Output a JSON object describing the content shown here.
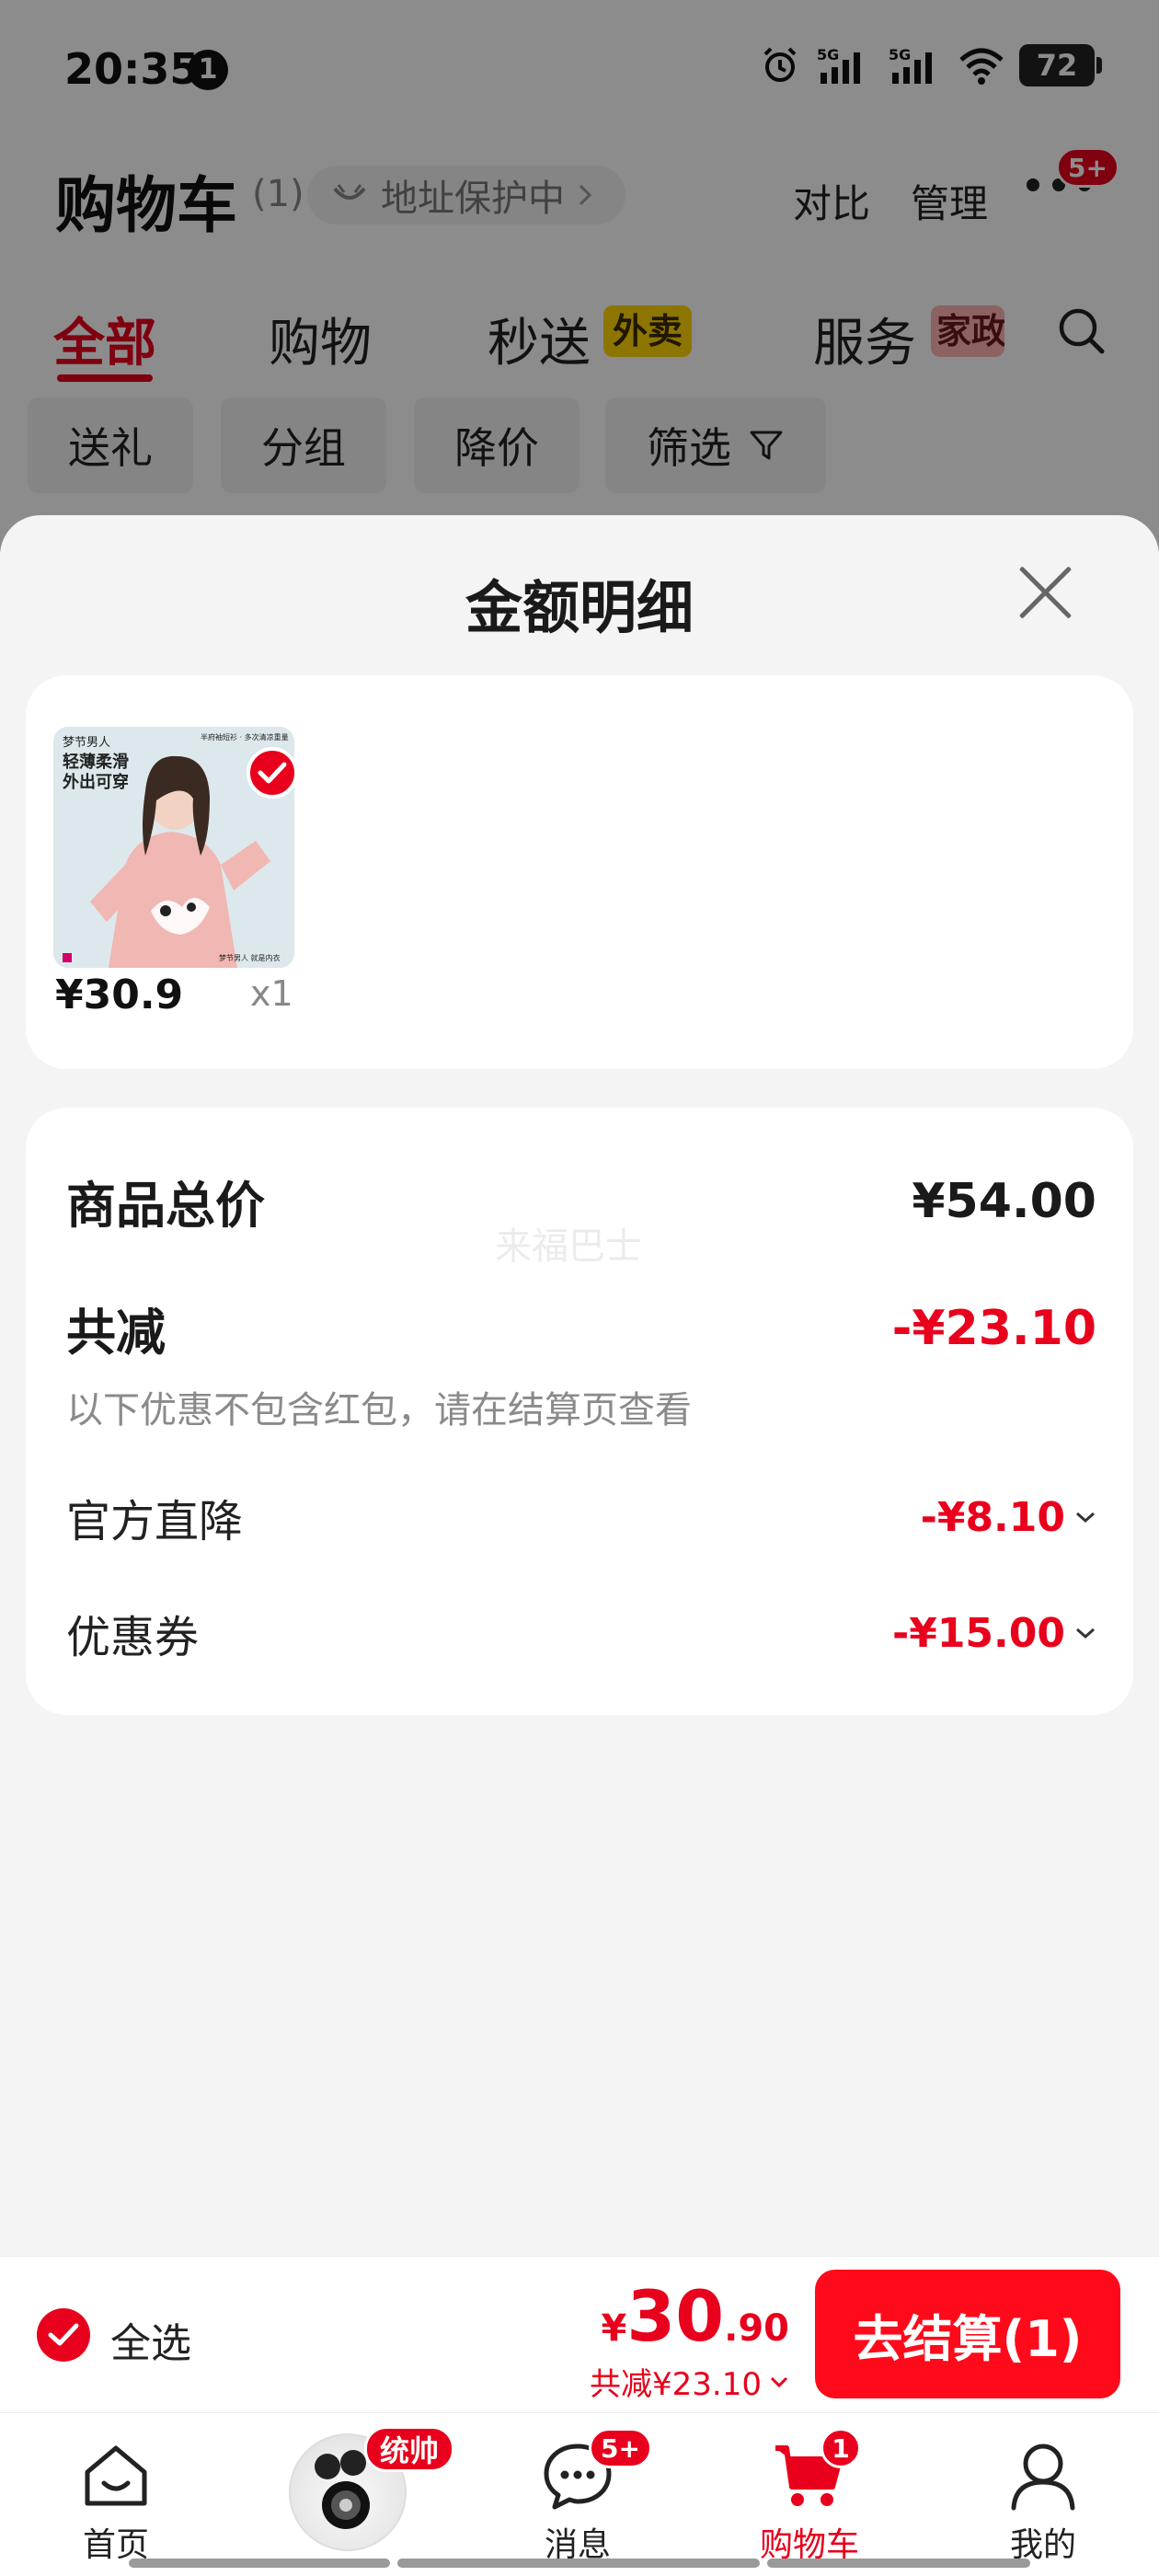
{
  "status_bar": {
    "time": "20:35",
    "notification_count": "1",
    "network_1": "5G",
    "network_2": "5G",
    "battery": "72"
  },
  "header": {
    "title": "购物车",
    "count": "(1)",
    "address_pill": "地址保护中",
    "compare": "对比",
    "manage": "管理",
    "more_badge": "5+"
  },
  "tabs": [
    {
      "label": "全部",
      "active": true
    },
    {
      "label": "购物"
    },
    {
      "label": "秒送",
      "tag": "外卖"
    },
    {
      "label": "服务",
      "tag": "家政"
    }
  ],
  "filters": [
    "送礼",
    "分组",
    "降价",
    "筛选"
  ],
  "sheet": {
    "title": "金额明细",
    "product": {
      "price": "¥30.9",
      "qty": "x1",
      "image_text": {
        "brand": "梦节男人",
        "line1": "轻薄柔滑",
        "line2": "外出可穿",
        "corner": "半府袖短衫 · 多次清凉重量",
        "footer": "梦节男人 就是内衣"
      }
    },
    "summary": {
      "total_label": "商品总价",
      "total_value": "¥54.00",
      "watermark": "来福巴士",
      "reduce_label": "共减",
      "reduce_value": "-¥23.10",
      "note": "以下优惠不包含红包，请在结算页查看",
      "items": [
        {
          "label": "官方直降",
          "value": "-¥8.10"
        },
        {
          "label": "优惠券",
          "value": "-¥15.00"
        }
      ]
    }
  },
  "checkout": {
    "select_all": "全选",
    "currency": "¥",
    "price_int": "30",
    "price_dec": ".90",
    "reduced": "共减¥23.10",
    "button": "去结算(1)"
  },
  "nav": {
    "home": "首页",
    "product_badge": "统帅",
    "messages": "消息",
    "messages_badge": "5+",
    "cart": "购物车",
    "cart_badge": "1",
    "me": "我的"
  },
  "colors": {
    "accent": "#e8001c",
    "button": "#ff0a1a",
    "sheet_bg": "#f4f4f4"
  }
}
